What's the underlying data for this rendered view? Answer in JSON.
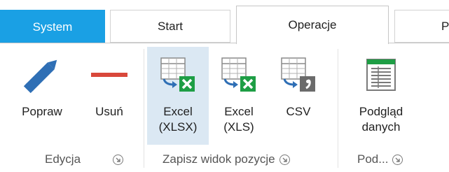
{
  "tabs": [
    {
      "label": "System",
      "active": false,
      "style": "accent"
    },
    {
      "label": "Start",
      "active": false
    },
    {
      "label": "Operacje",
      "active": true
    },
    {
      "label": "P",
      "active": false
    }
  ],
  "buttons": {
    "popraw": {
      "label": "Popraw",
      "icon": "pencil-icon"
    },
    "usun": {
      "label": "Usuń",
      "icon": "minus-icon"
    },
    "excel_xlsx": {
      "label": "Excel\n(XLSX)",
      "icon": "excel-export-icon",
      "selected": true
    },
    "excel_xls": {
      "label": "Excel\n(XLS)",
      "icon": "excel-export-icon"
    },
    "csv": {
      "label": "CSV",
      "icon": "csv-export-icon"
    },
    "podglad": {
      "label": "Podgląd\ndanych",
      "icon": "data-preview-icon"
    }
  },
  "groups": {
    "edycja": "Edycja",
    "zapisz": "Zapisz widok pozycje",
    "podglad": "Pod..."
  },
  "colors": {
    "accent": "#1aa0e4",
    "pencil": "#2f6fb5",
    "minus": "#d9483b",
    "excel_green": "#1e9e45",
    "selected_bg": "#dbe8f3"
  }
}
